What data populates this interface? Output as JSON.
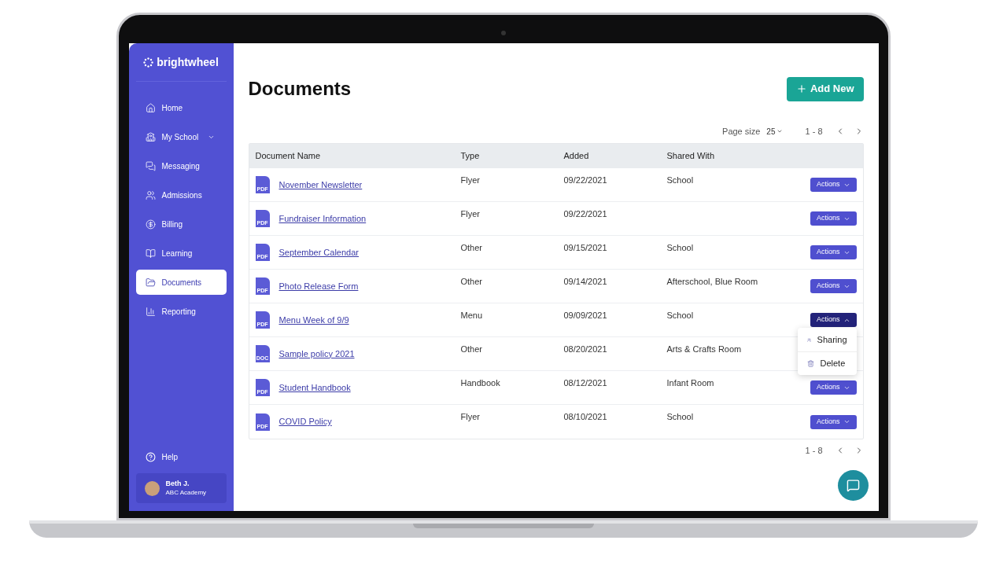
{
  "sidebar": {
    "brand": "brightwheel",
    "items": [
      {
        "label": "Home",
        "kind": "home",
        "selected": false
      },
      {
        "label": "My School",
        "kind": "school",
        "selected": false,
        "has_submenu": true
      },
      {
        "label": "Messaging",
        "kind": "messaging",
        "selected": false
      },
      {
        "label": "Admissions",
        "kind": "admissions",
        "selected": false
      },
      {
        "label": "Billing",
        "kind": "billing",
        "selected": false
      },
      {
        "label": "Learning",
        "kind": "learning",
        "selected": false
      },
      {
        "label": "Documents",
        "kind": "documents",
        "selected": true
      },
      {
        "label": "Reporting",
        "kind": "reporting",
        "selected": false
      }
    ],
    "help": "Help",
    "user": {
      "name": "Beth J.",
      "school": "ABC Academy"
    }
  },
  "page": {
    "title": "Documents",
    "add_button": "Add New"
  },
  "pagination": {
    "page_size_label": "Page size",
    "page_size": "25",
    "range": "1 - 8",
    "bottom_range": "1 - 8"
  },
  "table": {
    "columns": [
      "Document Name",
      "Type",
      "Added",
      "Shared With"
    ],
    "rows": [
      {
        "file_label": "PDF",
        "name": "November Newsletter",
        "type": "Flyer",
        "added": "09/22/2021",
        "shared": "School",
        "actions": {
          "label": "Actions",
          "expanded": false
        }
      },
      {
        "file_label": "PDF",
        "name": "Fundraiser Information",
        "type": "Flyer",
        "added": "09/22/2021",
        "shared": "",
        "actions": {
          "label": "Actions",
          "expanded": false
        }
      },
      {
        "file_label": "PDF",
        "name": "September Calendar",
        "type": "Other",
        "added": "09/15/2021",
        "shared": "School",
        "actions": {
          "label": "Actions",
          "expanded": false
        }
      },
      {
        "file_label": "PDF",
        "name": "Photo Release Form",
        "type": "Other",
        "added": "09/14/2021",
        "shared": "Afterschool, Blue Room",
        "actions": {
          "label": "Actions",
          "expanded": false
        }
      },
      {
        "file_label": "PDF",
        "name": "Menu Week of 9/9",
        "type": "Menu",
        "added": "09/09/2021",
        "shared": "School",
        "actions": {
          "label": "Actions",
          "expanded": true,
          "menu": [
            {
              "label": "Sharing",
              "kind": "sharing"
            },
            {
              "label": "Delete",
              "kind": "delete"
            }
          ]
        }
      },
      {
        "file_label": "DOC",
        "name": "Sample policy 2021",
        "type": "Other",
        "added": "08/20/2021",
        "shared": "Arts & Crafts Room"
      },
      {
        "file_label": "PDF",
        "name": "Student Handbook",
        "type": "Handbook",
        "added": "08/12/2021",
        "shared": "Infant Room",
        "actions": {
          "label": "Actions",
          "expanded": false
        }
      },
      {
        "file_label": "PDF",
        "name": "COVID Policy",
        "type": "Flyer",
        "added": "08/10/2021",
        "shared": "School",
        "actions": {
          "label": "Actions",
          "expanded": false
        }
      }
    ]
  }
}
